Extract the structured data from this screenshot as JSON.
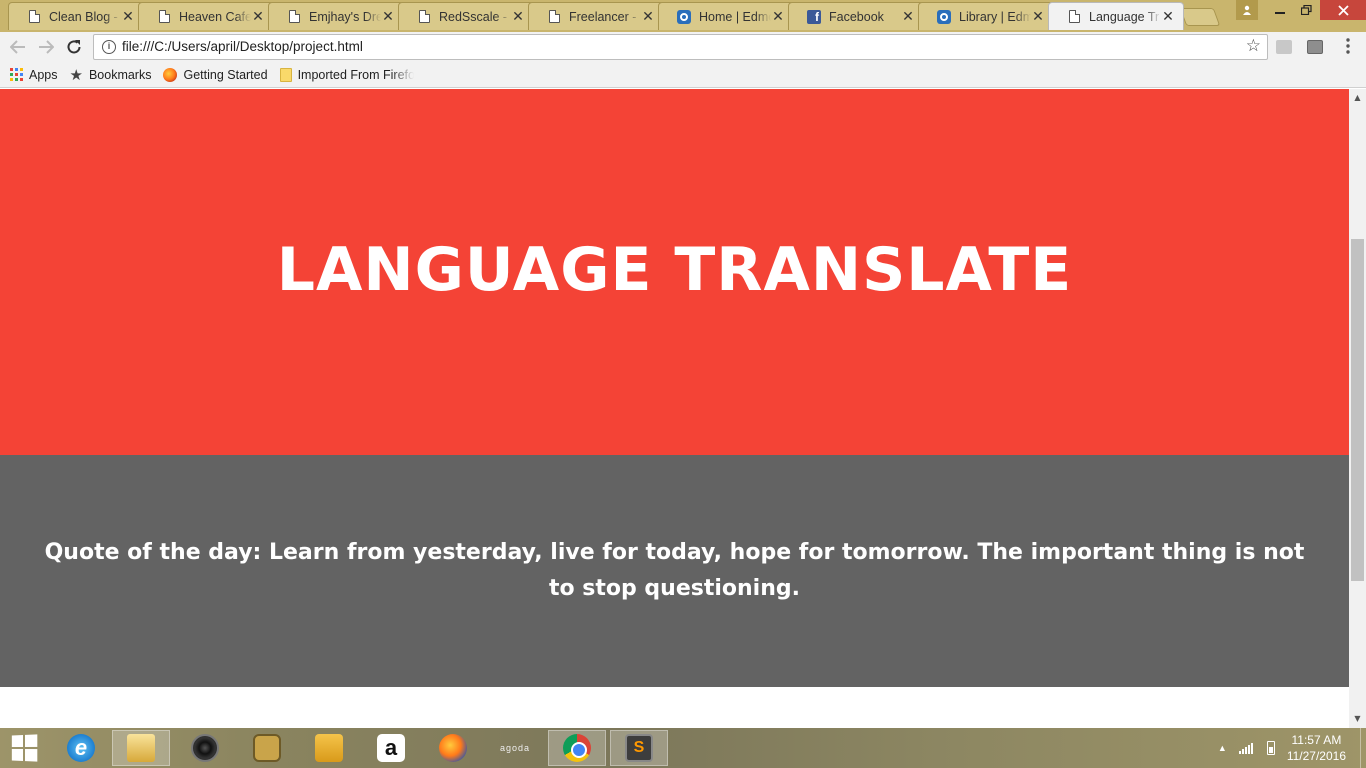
{
  "browser": {
    "tabs": [
      {
        "title": "Clean Blog -",
        "icon": "document-icon"
      },
      {
        "title": "Heaven Cafe",
        "icon": "document-icon"
      },
      {
        "title": "Emjhay's Dre",
        "icon": "document-icon"
      },
      {
        "title": "RedSscale - L",
        "icon": "document-icon"
      },
      {
        "title": "Freelancer - F",
        "icon": "document-icon"
      },
      {
        "title": "Home | Edmo",
        "icon": "edmodo-icon"
      },
      {
        "title": "Facebook",
        "icon": "facebook-icon"
      },
      {
        "title": "Library | Edm",
        "icon": "edmodo-icon"
      },
      {
        "title": "Language Tr",
        "icon": "document-icon",
        "active": true
      }
    ],
    "tab_close_glyph": "✕",
    "url": "file:///C:/Users/april/Desktop/project.html",
    "bookmarks": [
      {
        "label": "Apps",
        "icon": "apps-grid-icon"
      },
      {
        "label": "Bookmarks",
        "icon": "star-icon"
      },
      {
        "label": "Getting Started",
        "icon": "firefox-icon"
      },
      {
        "label": "Imported From Firefox",
        "icon": "folder-icon"
      }
    ]
  },
  "page": {
    "hero_title": "LANGUAGE TRANSLATE",
    "quote": "Quote of the day: Learn from yesterday, live for today, hope for tomorrow. The important thing is not to stop questioning.",
    "colors": {
      "hero_bg": "#f44336",
      "quote_bg": "#636363",
      "text": "#ffffff"
    }
  },
  "taskbar": {
    "apps": [
      {
        "name": "internet-explorer-icon"
      },
      {
        "name": "file-explorer-icon"
      },
      {
        "name": "speaker-app-icon"
      },
      {
        "name": "camera-app-icon"
      },
      {
        "name": "notes-app-icon"
      },
      {
        "name": "amazon-icon",
        "glyph": "a"
      },
      {
        "name": "firefox-icon"
      },
      {
        "name": "agoda-icon",
        "glyph": "agoda"
      },
      {
        "name": "chrome-icon",
        "active": true
      },
      {
        "name": "sublime-text-icon",
        "glyph": "S"
      }
    ],
    "clock": {
      "time": "11:57 AM",
      "date": "11/27/2016"
    }
  }
}
